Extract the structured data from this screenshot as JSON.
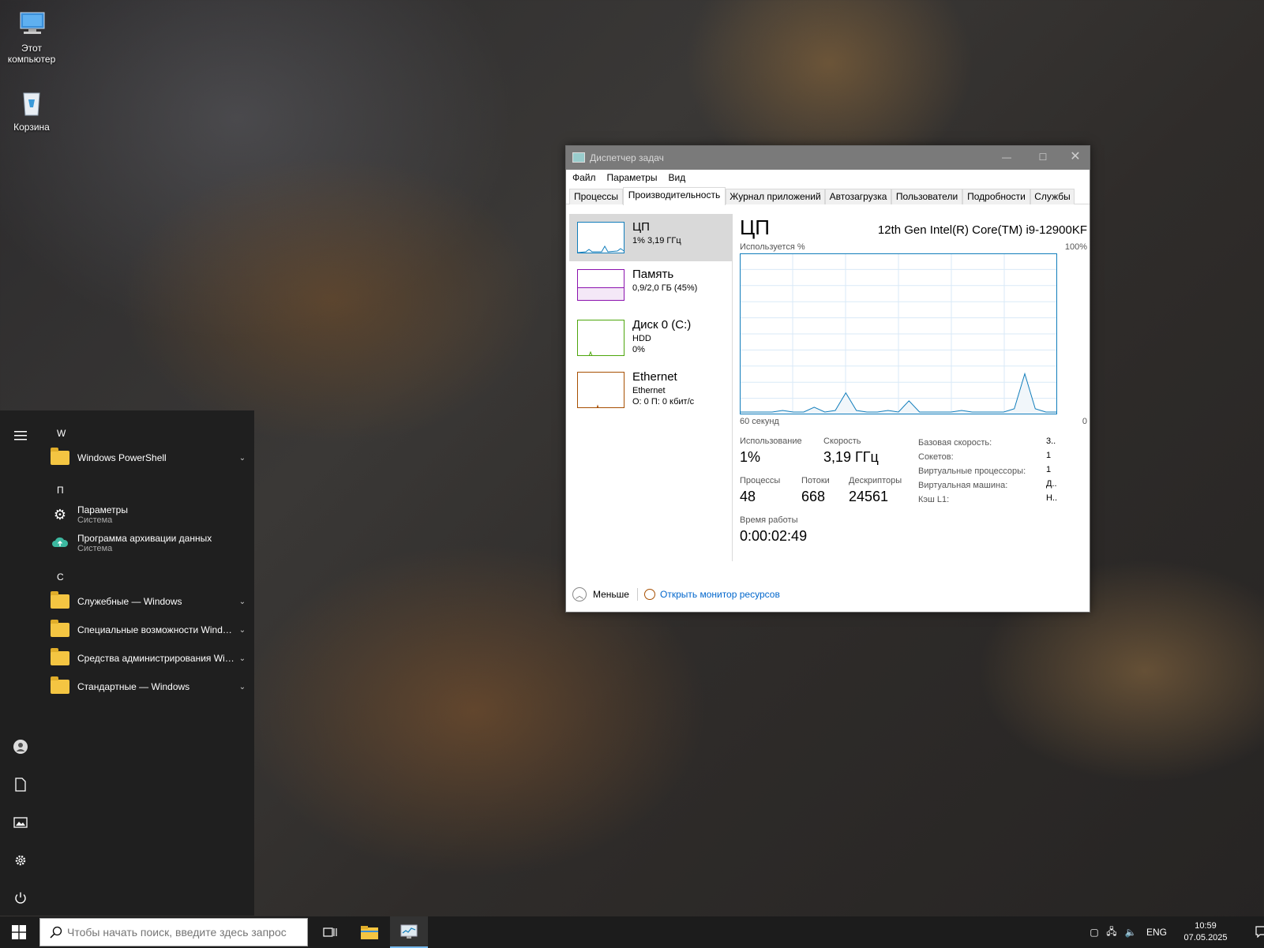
{
  "desktop": {
    "icons": [
      {
        "label": "Этот компьютер"
      },
      {
        "label": "Корзина"
      }
    ]
  },
  "start_menu": {
    "groups": [
      {
        "letter": "W",
        "items": [
          {
            "label": "Windows PowerShell",
            "type": "folder"
          }
        ]
      },
      {
        "letter": "П",
        "items": [
          {
            "label": "Параметры",
            "sub": "Система",
            "icon": "gear-icon"
          },
          {
            "label": "Программа архивации данных",
            "sub": "Система",
            "icon": "backup-cloud-icon"
          }
        ]
      },
      {
        "letter": "С",
        "items": [
          {
            "label": "Служебные — Windows",
            "type": "folder"
          },
          {
            "label": "Специальные возможности Windows",
            "type": "folder"
          },
          {
            "label": "Средства администрирования Windows",
            "type": "folder"
          },
          {
            "label": "Стандартные — Windows",
            "type": "folder"
          }
        ]
      }
    ],
    "rail": [
      "hamburger-icon",
      "user-icon",
      "document-icon",
      "pictures-icon",
      "settings-icon",
      "power-icon"
    ]
  },
  "taskbar": {
    "search_placeholder": "Чтобы начать поиск, введите здесь запрос",
    "tray": {
      "lang": "ENG",
      "time": "10:59",
      "date": "07.05.2025"
    }
  },
  "task_manager": {
    "title": "Диспетчер задач",
    "menu": [
      "Файл",
      "Параметры",
      "Вид"
    ],
    "tabs": [
      "Процессы",
      "Производительность",
      "Журнал приложений",
      "Автозагрузка",
      "Пользователи",
      "Подробности",
      "Службы"
    ],
    "active_tab": "Производительность",
    "resources": [
      {
        "name": "ЦП",
        "line2": "1% 3,19 ГГц",
        "line3": "",
        "color": "#117dbb"
      },
      {
        "name": "Память",
        "line2": "0,9/2,0 ГБ (45%)",
        "line3": "",
        "color": "#8b12ae"
      },
      {
        "name": "Диск 0 (C:)",
        "line2": "HDD",
        "line3": "0%",
        "color": "#4da60c"
      },
      {
        "name": "Ethernet",
        "line2": "Ethernet",
        "line3": "О: 0 П: 0 кбит/с",
        "color": "#a74f01"
      }
    ],
    "cpu": {
      "heading": "ЦП",
      "model": "12th Gen Intel(R) Core(TM) i9-12900KF",
      "graph_label": "Используется %",
      "graph_max": "100%",
      "graph_left": "60 секунд",
      "graph_right": "0",
      "usage_label": "Использование",
      "usage": "1%",
      "speed_label": "Скорость",
      "speed": "3,19 ГГц",
      "processes_label": "Процессы",
      "processes": "48",
      "threads_label": "Потоки",
      "threads": "668",
      "handles_label": "Дескрипторы",
      "handles": "24561",
      "uptime_label": "Время работы",
      "uptime": "0:00:02:49",
      "specs": [
        {
          "k": "Базовая скорость:",
          "v": "3.."
        },
        {
          "k": "Сокетов:",
          "v": "1"
        },
        {
          "k": "Виртуальные процессоры:",
          "v": "1"
        },
        {
          "k": "Виртуальная машина:",
          "v": "Д.."
        },
        {
          "k": "Кэш L1:",
          "v": "Н.."
        }
      ]
    },
    "footer": {
      "less": "Меньше",
      "monitor": "Открыть монитор ресурсов"
    }
  },
  "chart_data": {
    "type": "line",
    "ylabel": "Используется %",
    "ylim": [
      0,
      100
    ],
    "xlabel": "60 секунд",
    "x": [
      0,
      2,
      4,
      6,
      8,
      10,
      12,
      14,
      16,
      18,
      20,
      22,
      24,
      26,
      28,
      30,
      32,
      34,
      36,
      38,
      40,
      42,
      44,
      46,
      48,
      50,
      52,
      54,
      56,
      58,
      60
    ],
    "values": [
      1,
      1,
      1,
      1,
      2,
      1,
      1,
      4,
      1,
      2,
      13,
      2,
      1,
      1,
      2,
      1,
      8,
      1,
      1,
      1,
      1,
      2,
      1,
      1,
      1,
      1,
      3,
      25,
      3,
      1,
      1
    ]
  }
}
